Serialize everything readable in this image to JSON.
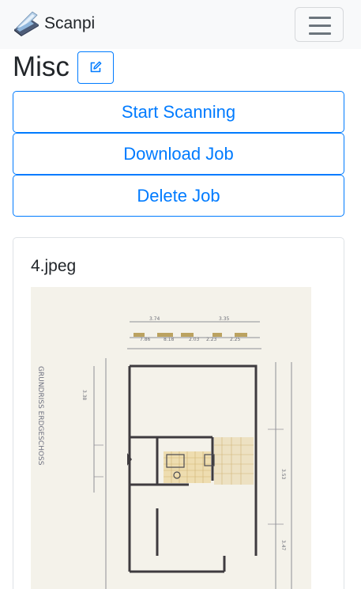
{
  "navbar": {
    "brand_icon": "scanner-icon",
    "brand_text": "Scanpi",
    "toggler_icon": "hamburger-menu-icon"
  },
  "job": {
    "title": "Misc",
    "edit_icon": "edit-pencil-icon"
  },
  "actions": {
    "start_scanning": "Start Scanning",
    "download_job": "Download Job",
    "delete_job": "Delete Job"
  },
  "scan_card": {
    "filename": "4.jpeg",
    "image_subject": "scanned floor plan drawing"
  },
  "colors": {
    "primary": "#007bff",
    "navbar_bg": "#f8f9fa",
    "text": "#212529"
  }
}
